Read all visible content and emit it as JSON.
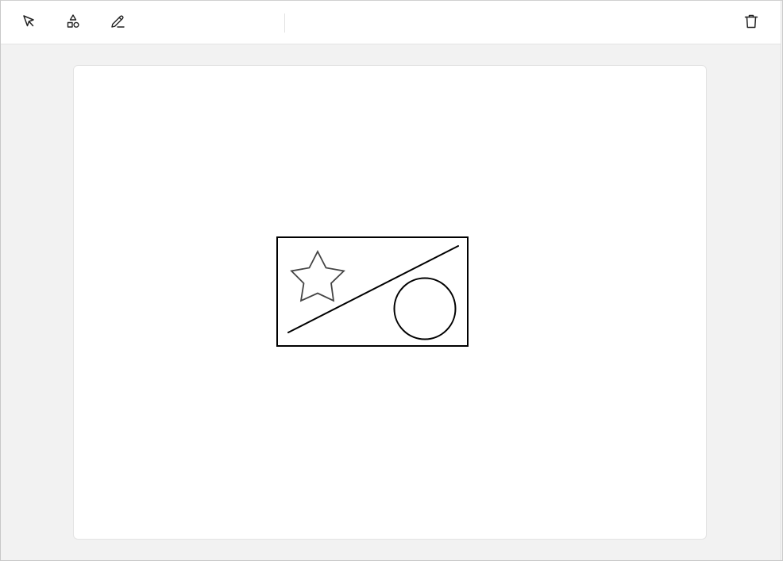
{
  "toolbar": {
    "tools": [
      {
        "name": "select",
        "icon": "cursor-arrow-icon"
      },
      {
        "name": "shapes",
        "icon": "shapes-icon"
      },
      {
        "name": "pen",
        "icon": "pen-icon"
      }
    ],
    "actions": [
      {
        "name": "delete",
        "icon": "trash-icon"
      }
    ]
  },
  "canvas": {
    "background": "#ffffff",
    "stroke_color": "#000000",
    "shapes": [
      {
        "type": "rectangle"
      },
      {
        "type": "star"
      },
      {
        "type": "line"
      },
      {
        "type": "circle"
      }
    ]
  },
  "colors": {
    "app_background": "#f2f2f2",
    "toolbar_background": "#ffffff",
    "icon_color": "#222222"
  }
}
